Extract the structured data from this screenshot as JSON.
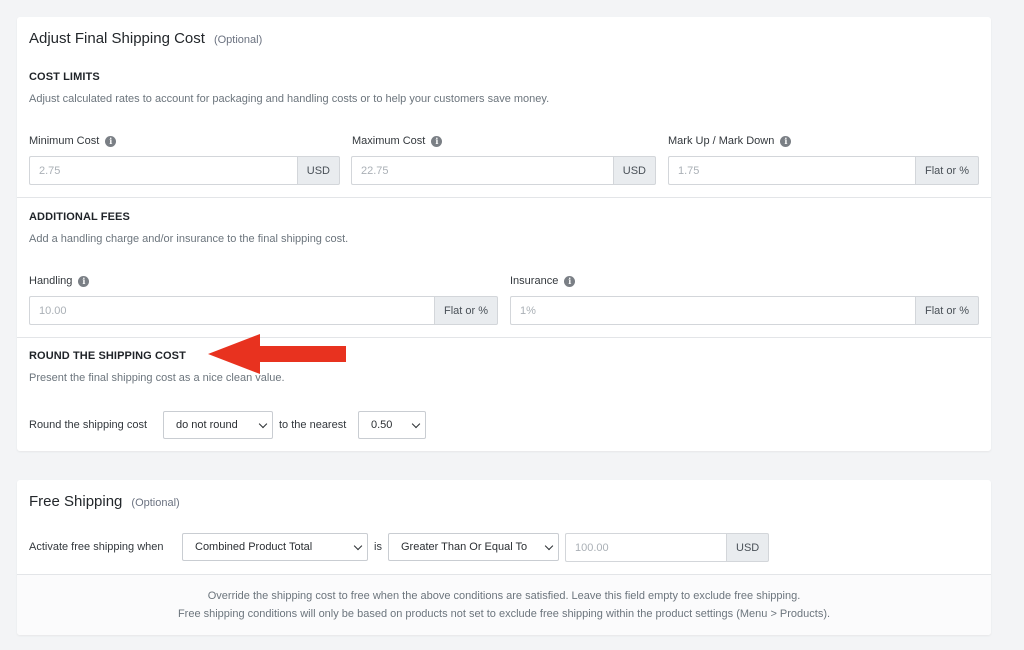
{
  "adjust": {
    "title": "Adjust Final Shipping Cost",
    "optional": "(Optional)",
    "cost_limits": {
      "title": "COST LIMITS",
      "desc": "Adjust calculated rates to account for packaging and handling costs or to help your customers save money.",
      "min": {
        "label": "Minimum Cost",
        "placeholder": "2.75",
        "addon": "USD"
      },
      "max": {
        "label": "Maximum Cost",
        "placeholder": "22.75",
        "addon": "USD"
      },
      "markup": {
        "label": "Mark Up / Mark Down",
        "placeholder": "1.75",
        "addon": "Flat or %"
      }
    },
    "fees": {
      "title": "ADDITIONAL FEES",
      "desc": "Add a handling charge and/or insurance to the final shipping cost.",
      "handling": {
        "label": "Handling",
        "placeholder": "10.00",
        "addon": "Flat or %"
      },
      "insurance": {
        "label": "Insurance",
        "placeholder": "1%",
        "addon": "Flat or %"
      }
    },
    "round": {
      "title": "ROUND THE SHIPPING COST",
      "desc": "Present the final shipping cost as a nice clean value.",
      "label": "Round the shipping cost",
      "select_value": "do not round",
      "nearest_label": "to the nearest",
      "nearest_value": "0.50"
    },
    "info_glyph": "i"
  },
  "free": {
    "title": "Free Shipping",
    "optional": "(Optional)",
    "activate_label": "Activate free shipping when",
    "condition_value": "Combined Product Total",
    "is_label": "is",
    "operator_value": "Greater Than Or Equal To",
    "amount_placeholder": "100.00",
    "amount_addon": "USD",
    "note_line1": "Override the shipping cost to free when the above conditions are satisfied. Leave this field empty to exclude free shipping.",
    "note_line2": "Free shipping conditions will only be based on products not set to exclude free shipping within the product settings (Menu > Products)."
  },
  "colors": {
    "arrow": "#e8321f",
    "page_bg": "#f3f4f6",
    "addon_bg": "#e9ecef"
  },
  "icons": {
    "info": "info-icon",
    "dropdown": "chevron-down-icon",
    "annotation": "red-arrow-icon"
  }
}
